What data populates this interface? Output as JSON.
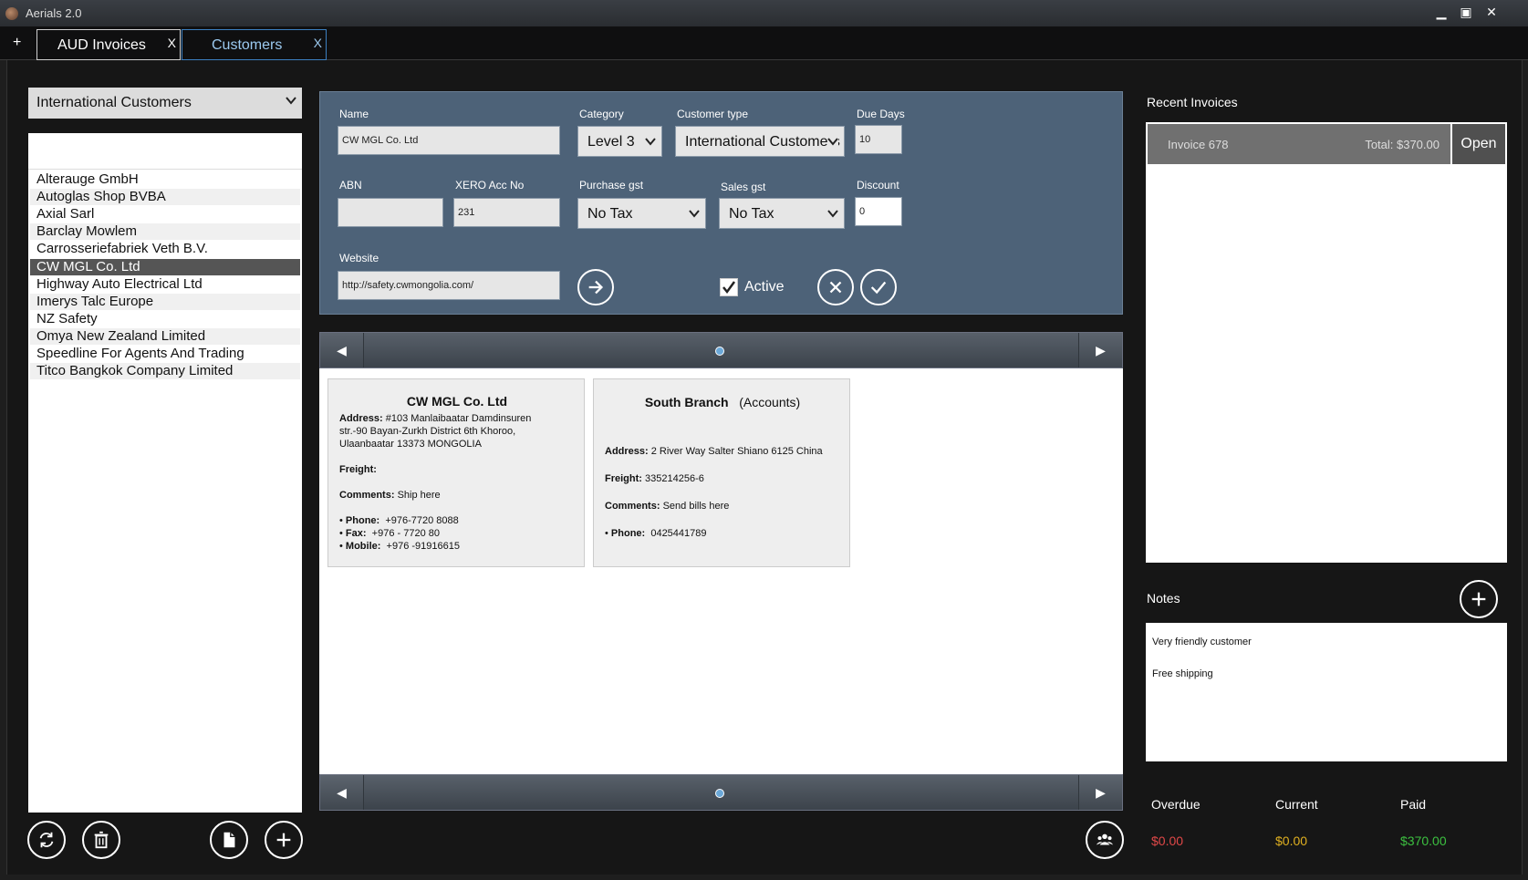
{
  "window": {
    "title": "Aerials 2.0",
    "min": "▁",
    "max": "▣",
    "close": "✕"
  },
  "tabs": {
    "add": "+",
    "items": [
      {
        "label": "AUD Invoices",
        "close": "X"
      },
      {
        "label": "Customers",
        "close": "X"
      }
    ]
  },
  "left": {
    "group_select": "International Customers",
    "customers": [
      "Alterauge GmbH",
      "Autoglas Shop BVBA",
      "Axial Sarl",
      "Barclay Mowlem",
      "Carrosseriefabriek Veth B.V.",
      "CW MGL Co. Ltd",
      "Highway Auto Electrical Ltd",
      "Imerys Talc Europe",
      "NZ Safety",
      "Omya New Zealand Limited",
      "Speedline For Agents And Trading",
      "Titco Bangkok Company Limited"
    ],
    "selected_index": 5
  },
  "form": {
    "name_label": "Name",
    "name": "CW MGL Co. Ltd",
    "category_label": "Category",
    "category": "Level 3",
    "customer_type_label": "Customer type",
    "customer_type": "International Customers",
    "due_days_label": "Due Days",
    "due_days": "10",
    "abn_label": "ABN",
    "abn": "",
    "xero_label": "XERO Acc No",
    "xero": "231",
    "purchase_gst_label": "Purchase gst",
    "purchase_gst": "No Tax",
    "sales_gst_label": "Sales gst",
    "sales_gst": "No Tax",
    "discount_label": "Discount",
    "discount": "0",
    "website_label": "Website",
    "website": "http://safety.cwmongolia.com/",
    "active_label": "Active",
    "active": true
  },
  "cards": [
    {
      "title": "CW  MGL  Co.  Ltd",
      "address_label": "Address:",
      "address_lines": [
        "#103  Manlaibaatar  Damdinsuren",
        "str.-90  Bayan-Zurkh  District  6th  Khoroo,",
        "Ulaanbaatar    13373  MONGOLIA"
      ],
      "freight_label": "Freight:",
      "freight": "",
      "comments_label": "Comments:",
      "comments": "Ship  here",
      "phone_label": "Phone:",
      "phone": "+976-7720  8088",
      "fax_label": "Fax:",
      "fax": "+976  -  7720  80",
      "mobile_label": "Mobile:",
      "mobile": "+976  -91916615"
    },
    {
      "title": "South  Branch",
      "subtitle": "(Accounts)",
      "address_label": "Address:",
      "address": "2  River  Way  Salter  Shiano  6125  China",
      "freight_label": "Freight:",
      "freight": "335214256-6",
      "comments_label": "Comments:",
      "comments": "Send  bills  here",
      "phone_label": "Phone:",
      "phone": "0425441789"
    }
  ],
  "recent": {
    "title": "Recent Invoices",
    "invoice": "Invoice 678",
    "total": "Total: $370.00",
    "open": "Open"
  },
  "notes": {
    "title": "Notes",
    "lines": [
      "Very friendly customer",
      "Free shipping"
    ]
  },
  "summary": {
    "overdue_label": "Overdue",
    "overdue": "$0.00",
    "current_label": "Current",
    "current": "$0.00",
    "paid_label": "Paid",
    "paid": "$370.00"
  },
  "colors": {
    "overdue": "#e04848",
    "current": "#e0b020",
    "paid": "#3cc040",
    "form_bg": "#4d6278"
  },
  "icons": [
    "refresh-icon",
    "trash-icon",
    "document-icon",
    "plus-icon",
    "arrow-right-icon",
    "cancel-icon",
    "check-icon",
    "contacts-icon"
  ]
}
